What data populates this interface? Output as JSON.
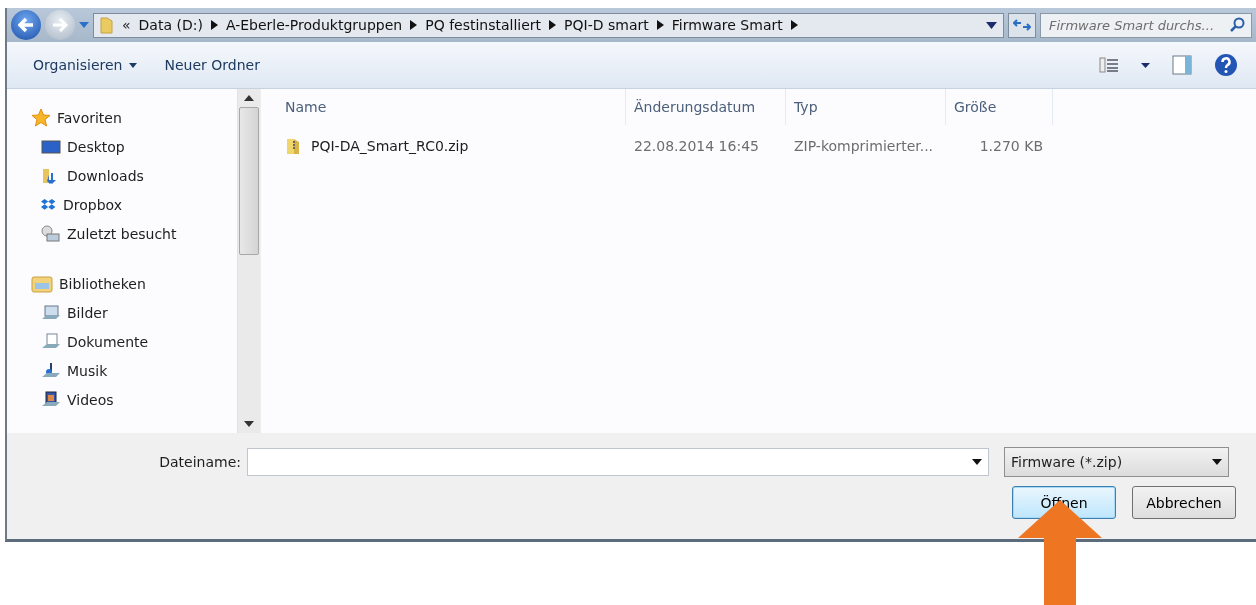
{
  "address_bar": {
    "overflow": "«",
    "crumbs": [
      "Data (D:)",
      "A-Eberle-Produktgruppen",
      "PQ festinstalliert",
      "PQI-D smart",
      "Firmware Smart"
    ]
  },
  "search": {
    "placeholder": "Firmware Smart durchs..."
  },
  "toolbar": {
    "items": [
      {
        "label": "Organisieren",
        "dropdown": true
      },
      {
        "label": "Neuer Ordner",
        "dropdown": false
      }
    ]
  },
  "sidebar": {
    "groups": [
      {
        "label": "Favoriten",
        "kind": "star",
        "children": [
          {
            "label": "Desktop",
            "kind": "desktop"
          },
          {
            "label": "Downloads",
            "kind": "downloads"
          },
          {
            "label": "Dropbox",
            "kind": "dropbox"
          },
          {
            "label": "Zuletzt besucht",
            "kind": "recent"
          }
        ]
      },
      {
        "label": "Bibliotheken",
        "kind": "library",
        "children": [
          {
            "label": "Bilder",
            "kind": "pictures"
          },
          {
            "label": "Dokumente",
            "kind": "documents"
          },
          {
            "label": "Musik",
            "kind": "music"
          },
          {
            "label": "Videos",
            "kind": "videos"
          }
        ]
      }
    ]
  },
  "file_list": {
    "columns": [
      "Name",
      "Änderungsdatum",
      "Typ",
      "Größe"
    ],
    "rows": [
      {
        "name": "PQI-DA_Smart_RC0.zip",
        "date": "22.08.2014 16:45",
        "type": "ZIP-komprimierter...",
        "size": "1.270 KB"
      }
    ]
  },
  "footer": {
    "filename_label": "Dateiname:",
    "filter": "Firmware (*.zip)",
    "buttons": [
      {
        "label": "Öffnen",
        "default": true
      },
      {
        "label": "Abbrechen",
        "default": false
      }
    ]
  }
}
